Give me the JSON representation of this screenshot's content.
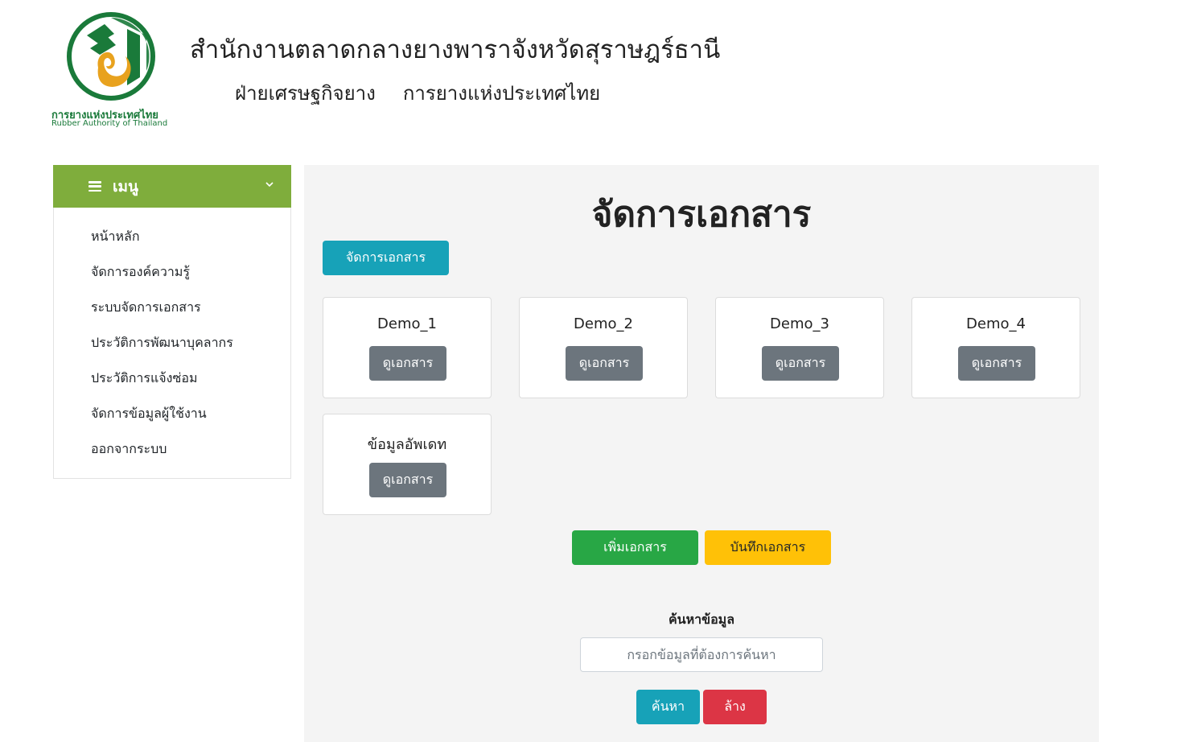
{
  "header": {
    "logo_th": "การยางแห่งประเทศไทย",
    "logo_en": "Rubber Authority of Thailand",
    "title": "สำนักงานตลาดกลางยางพาราจังหวัดสุราษฎร์ธานี",
    "subtitle_left": "ฝ่ายเศรษฐกิจยาง",
    "subtitle_right": "การยางแห่งประเทศไทย"
  },
  "sidebar": {
    "menu_title": "เมนู",
    "items": [
      {
        "label": "หน้าหลัก"
      },
      {
        "label": "จัดการองค์ความรู้"
      },
      {
        "label": "ระบบจัดการเอกสาร"
      },
      {
        "label": "ประวัติการพัฒนาบุคลากร"
      },
      {
        "label": "ประวัติการแจ้งซ่อม"
      },
      {
        "label": "จัดการข้อมูลผู้ใช้งาน"
      },
      {
        "label": "ออกจากระบบ"
      }
    ]
  },
  "main": {
    "title": "จัดการเอกสาร",
    "manage_button": "จัดการเอกสาร",
    "documents": [
      {
        "name": "Demo_1",
        "view_label": "ดูเอกสาร"
      },
      {
        "name": "Demo_2",
        "view_label": "ดูเอกสาร"
      },
      {
        "name": "Demo_3",
        "view_label": "ดูเอกสาร"
      },
      {
        "name": "Demo_4",
        "view_label": "ดูเอกสาร"
      },
      {
        "name": "ข้อมูลอัพเดท",
        "view_label": "ดูเอกสาร"
      }
    ],
    "add_button": "เพิ่มเอกสาร",
    "save_button": "บันทึกเอกสาร",
    "search": {
      "label": "ค้นหาข้อมูล",
      "placeholder": "กรอกข้อมูลที่ต้องการค้นหา",
      "value": "",
      "search_button": "ค้นหา",
      "clear_button": "ล้าง"
    }
  },
  "colors": {
    "menu_green": "#7fad3c",
    "brand_green": "#1a7a3a",
    "logo_gold": "#e8a21e",
    "info": "#17a2b8",
    "secondary": "#6c757d",
    "success": "#28a745",
    "warning": "#ffc107",
    "danger": "#dc3545"
  },
  "icons": {
    "menu": "hamburger-icon",
    "dropdown": "chevron-down-icon",
    "logo": "rubber-authority-logo"
  }
}
